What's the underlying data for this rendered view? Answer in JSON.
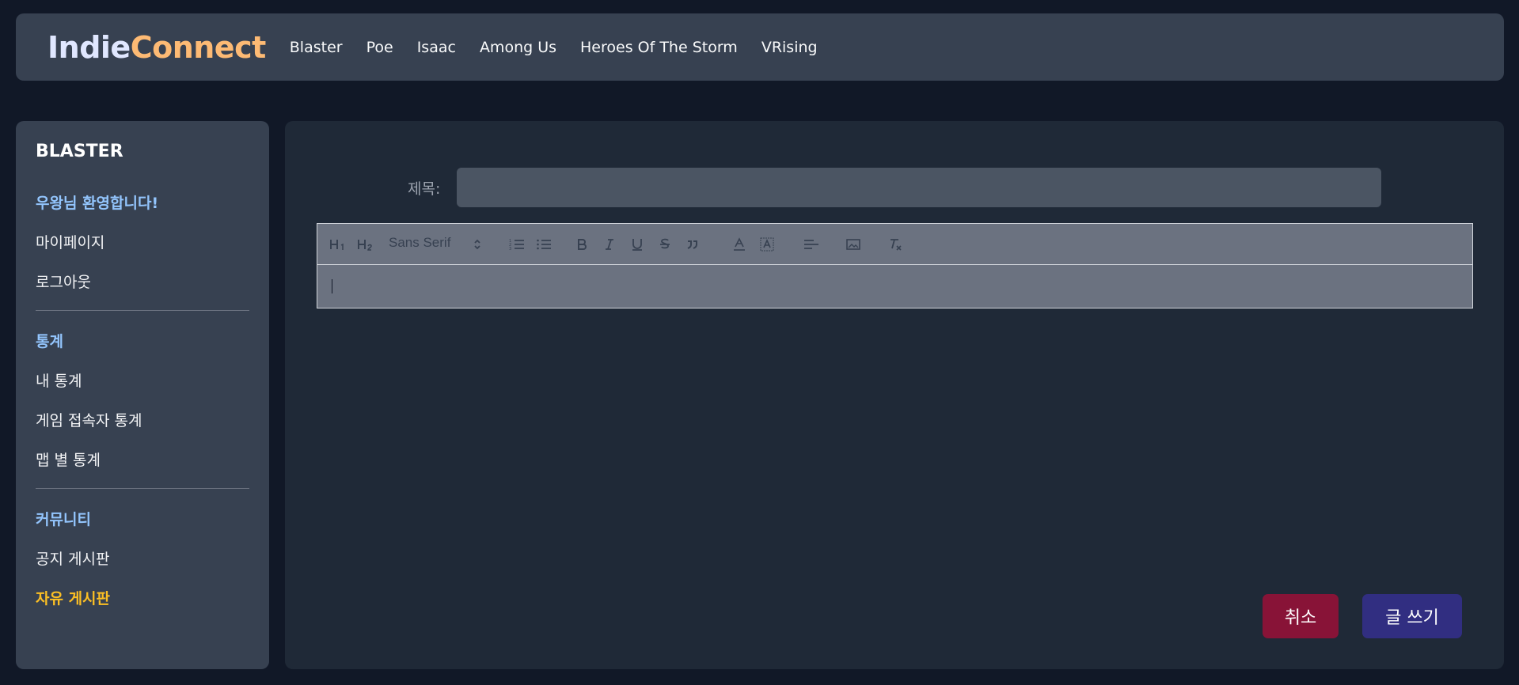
{
  "header": {
    "logo_part1": "Indie",
    "logo_part2": "Connect",
    "nav": [
      "Blaster",
      "Poe",
      "Isaac",
      "Among Us",
      "Heroes Of The Storm",
      "VRising"
    ]
  },
  "sidebar": {
    "title": "BLASTER",
    "welcome": "우왕님 환영합니다!",
    "my_page": "마이페이지",
    "logout": "로그아웃",
    "stats_section": "통계",
    "my_stats": "내 통계",
    "game_stats": "게임 접속자 통계",
    "map_stats": "맵 별 통계",
    "community_section": "커뮤니티",
    "notice_board": "공지 게시판",
    "free_board": "자유 게시판"
  },
  "form": {
    "title_label": "제목:",
    "title_value": "",
    "font_name": "Sans Serif",
    "body_value": ""
  },
  "buttons": {
    "cancel": "취소",
    "submit": "글 쓰기"
  },
  "colors": {
    "accent_logo": "#fdba74",
    "active_item": "#fbbf24",
    "section_heading": "#93c5fd",
    "cancel_button": "#881337",
    "submit_button": "#312e81"
  }
}
